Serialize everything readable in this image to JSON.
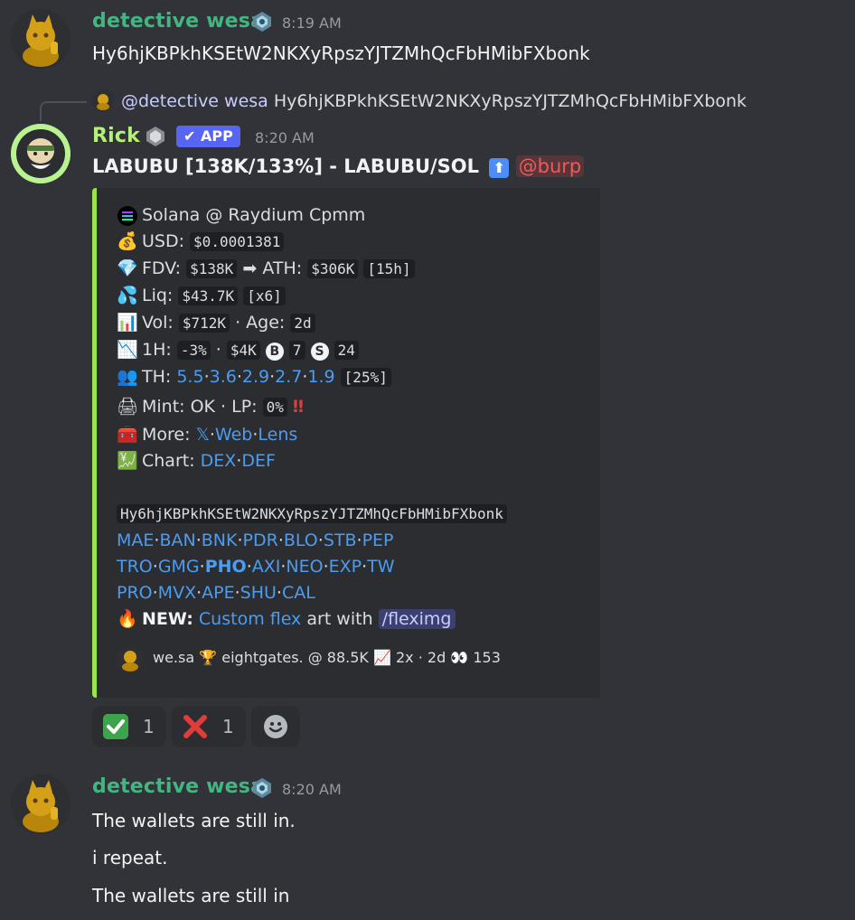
{
  "messages": [
    {
      "author": "detective wesa",
      "time": "8:19 AM",
      "text": "Hy6hjKBPkhKSEtW2NKXyRpszYJTZMhQcFbHMibFXbonk"
    },
    {
      "reply": {
        "mention": "@detective wesa",
        "text": "Hy6hjKBPkhKSEtW2NKXyRpszYJTZMhQcFbHMibFXbonk"
      },
      "author": "Rick",
      "app_badge": "APP",
      "time": "8:20 AM",
      "title": "LABUBU [138K/133%] - LABUBU/SOL",
      "title_mention": "@burp",
      "embed": {
        "chain": "Solana @ Raydium Cpmm",
        "usd_label": "USD:",
        "usd_value": "$0.0001381",
        "fdv_label": "FDV:",
        "fdv_value": "$138K",
        "ath_label": "ATH:",
        "ath_value": "$306K",
        "ath_time": "[15h]",
        "liq_label": "Liq:",
        "liq_value": "$43.7K",
        "liq_mult": "[x6]",
        "vol_label": "Vol:",
        "vol_value": "$712K",
        "age_label": "· Age:",
        "age_value": "2d",
        "h1_label": "1H:",
        "h1_change": "-3%",
        "h1_vol": "$4K",
        "h1_buys": "7",
        "h1_sells": "24",
        "th_label": "TH:",
        "th_values": [
          "5.5",
          "3.6",
          "2.9",
          "2.7",
          "1.9"
        ],
        "th_pct": "[25%]",
        "mint_label": "Mint: OK · LP:",
        "lp_value": "0%",
        "more_label": "More:",
        "more_links": [
          "𝕏",
          "Web",
          "Lens"
        ],
        "chart_label": "Chart:",
        "chart_links": [
          "DEX",
          "DEF"
        ],
        "address": "Hy6hjKBPkhKSEtW2NKXyRpszYJTZMhQcFbHMibFXbonk",
        "bot_row1": [
          "MAE",
          "BAN",
          "BNK",
          "PDR",
          "BLO",
          "STB",
          "PEP"
        ],
        "bot_row2": [
          "TRO",
          "GMG",
          "PHO",
          "AXI",
          "NEO",
          "EXP",
          "TW"
        ],
        "bot_row3": [
          "PRO",
          "MVX",
          "APE",
          "SHU",
          "CAL"
        ],
        "new_label": "NEW:",
        "new_link": "Custom flex",
        "new_text": "art with",
        "new_cmd": "/fleximg",
        "footer": "we.sa 🏆 eightgates. @ 88.5K 📈 2x · 2d 👀 153"
      },
      "reactions": [
        {
          "icon": "check-mark",
          "count": "1"
        },
        {
          "icon": "cross-mark",
          "count": "1"
        }
      ]
    },
    {
      "author": "detective wesa",
      "time": "8:20 AM",
      "lines": [
        "The wallets are still in.",
        "i repeat.",
        "The wallets are still in"
      ]
    }
  ]
}
